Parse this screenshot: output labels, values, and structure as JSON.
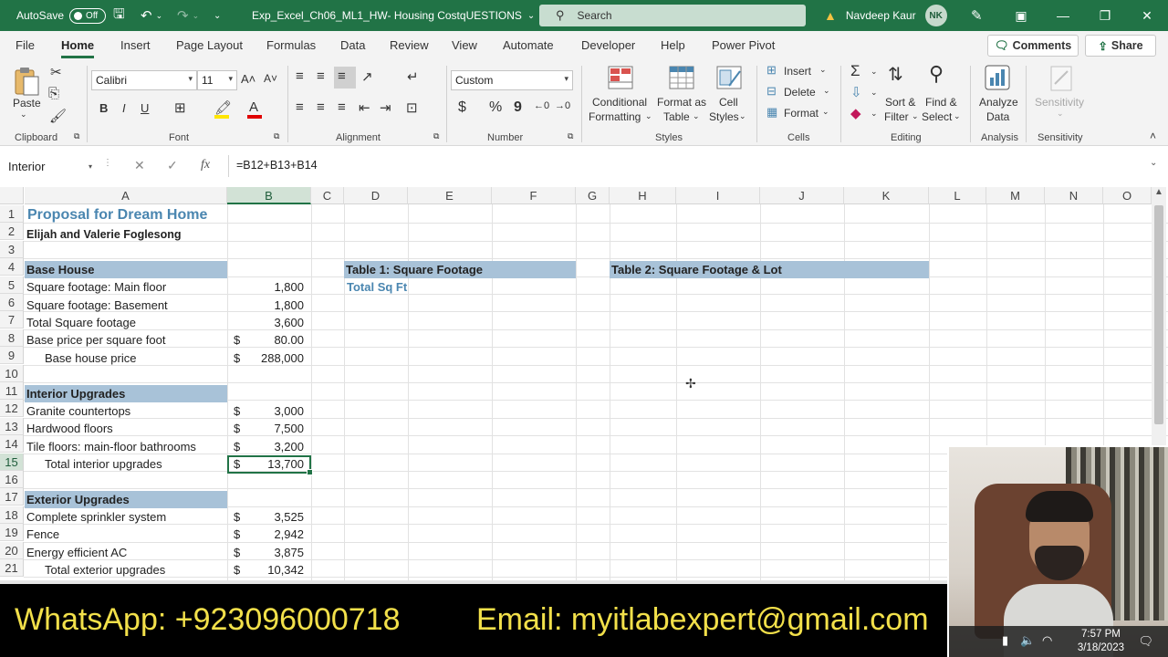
{
  "titlebar": {
    "autosave_label": "AutoSave",
    "autosave_state": "Off",
    "doc_title": "Exp_Excel_Ch06_ML1_HW- Housing CostqUESTIONS",
    "search_placeholder": "Search",
    "user_name": "Navdeep Kaur",
    "user_initials": "NK"
  },
  "menu": {
    "tabs": [
      "File",
      "Home",
      "Insert",
      "Page Layout",
      "Formulas",
      "Data",
      "Review",
      "View",
      "Automate",
      "Developer",
      "Help",
      "Power Pivot"
    ],
    "active": "Home",
    "comments_label": "Comments",
    "share_label": "Share"
  },
  "ribbon": {
    "clipboard": {
      "paste": "Paste",
      "label": "Clipboard"
    },
    "font": {
      "name": "Calibri",
      "size": "11",
      "label": "Font",
      "bold": "B",
      "italic": "I",
      "underline": "U"
    },
    "alignment": {
      "label": "Alignment"
    },
    "number": {
      "format": "Custom",
      "label": "Number",
      "currency": "$",
      "percent": "%",
      "comma": "9"
    },
    "styles": {
      "conditional_1": "Conditional",
      "conditional_2": "Formatting",
      "format_table_1": "Format as",
      "format_table_2": "Table",
      "cell_styles_1": "Cell",
      "cell_styles_2": "Styles",
      "label": "Styles"
    },
    "cells": {
      "insert": "Insert",
      "delete": "Delete",
      "format": "Format",
      "label": "Cells"
    },
    "editing": {
      "sort_1": "Sort &",
      "sort_2": "Filter",
      "find_1": "Find &",
      "find_2": "Select",
      "label": "Editing"
    },
    "analysis": {
      "analyze_1": "Analyze",
      "analyze_2": "Data",
      "label": "Analysis"
    },
    "sensitivity": {
      "button": "Sensitivity",
      "label": "Sensitivity"
    }
  },
  "formula_bar": {
    "name_box": "Interior",
    "fx": "fx",
    "formula": "=B12+B13+B14"
  },
  "columns": [
    "A",
    "B",
    "C",
    "D",
    "E",
    "F",
    "G",
    "H",
    "I",
    "J",
    "K",
    "L",
    "M",
    "N",
    "O"
  ],
  "rows": [
    "1",
    "2",
    "3",
    "4",
    "5",
    "6",
    "7",
    "8",
    "9",
    "10",
    "11",
    "12",
    "13",
    "14",
    "15",
    "16",
    "17",
    "18",
    "19",
    "20",
    "21"
  ],
  "sheet": {
    "a1": "Proposal for Dream Home",
    "a2": "Elijah and Valerie Foglesong",
    "a4": "Base House",
    "a5": "Square footage: Main floor",
    "b5": "1,800",
    "a6": "Square footage: Basement",
    "b6": "1,800",
    "a7": "Total Square footage",
    "b7": "3,600",
    "a8": "Base price per square foot",
    "b8_sym": "$",
    "b8": "80.00",
    "a9": "Base house price",
    "b9_sym": "$",
    "b9": "288,000",
    "a11": "Interior Upgrades",
    "a12": "Granite countertops",
    "b12_sym": "$",
    "b12": "3,000",
    "a13": "Hardwood floors",
    "b13_sym": "$",
    "b13": "7,500",
    "a14": "Tile floors: main-floor bathrooms",
    "b14_sym": "$",
    "b14": "3,200",
    "a15": "Total interior upgrades",
    "b15_sym": "$",
    "b15": "13,700",
    "a17": "Exterior Upgrades",
    "a18": "Complete sprinkler system",
    "b18_sym": "$",
    "b18": "3,525",
    "a19": "Fence",
    "b19_sym": "$",
    "b19": "2,942",
    "a20": "Energy efficient AC",
    "b20_sym": "$",
    "b20": "3,875",
    "a21": "Total exterior upgrades",
    "b21_sym": "$",
    "b21": "10,342",
    "d4": "Table 1: Square Footage",
    "d5": "Total Sq Ft",
    "h4": "Table 2: Square Footage & Lot"
  },
  "banner": {
    "whatsapp": "WhatsApp: +923096000718",
    "email": "Email: myitlabexpert@gmail.com"
  },
  "taskbar": {
    "time": "7:57 PM",
    "date": "3/18/2023"
  },
  "colors": {
    "excel_green": "#217346",
    "header_band": "#a8c2d8",
    "title_blue": "#4a86b0",
    "banner_text": "#f2e04a"
  }
}
